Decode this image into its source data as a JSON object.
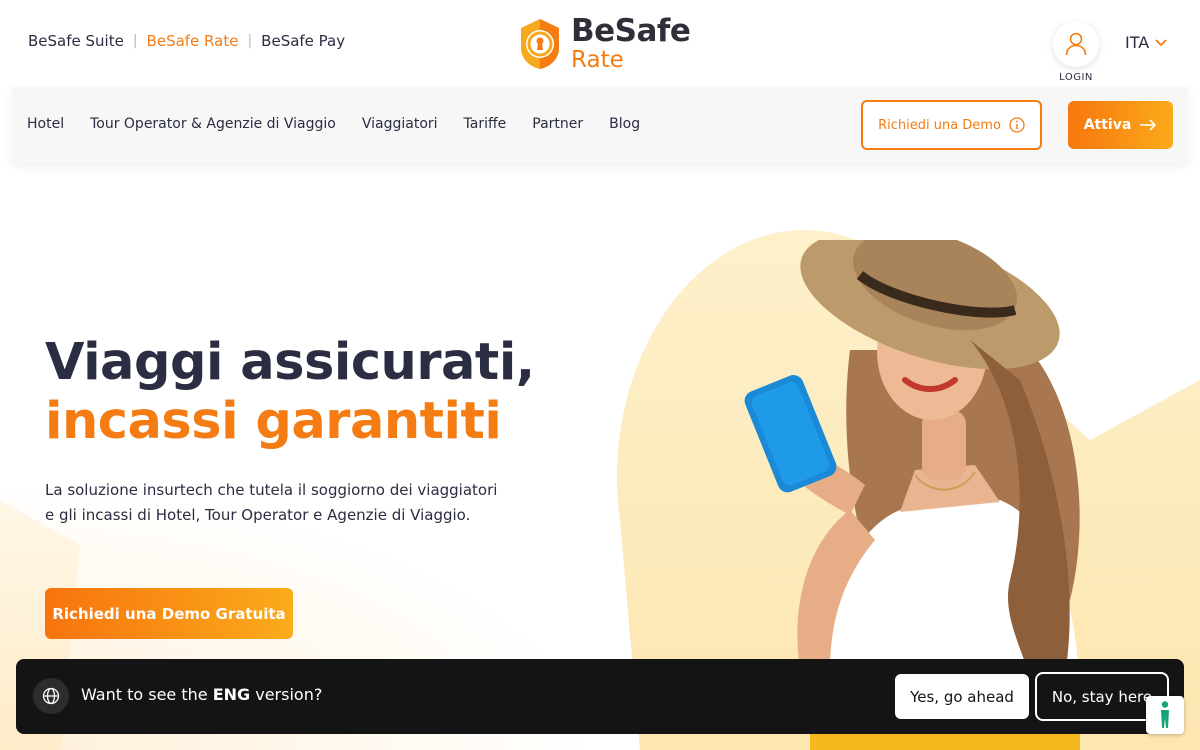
{
  "suite_nav": {
    "items": [
      {
        "label": "BeSafe Suite",
        "active": false
      },
      {
        "label": "BeSafe Rate",
        "active": true
      },
      {
        "label": "BeSafe Pay",
        "active": false
      }
    ],
    "separator": "|"
  },
  "logo": {
    "line1": "BeSafe",
    "line2": "Rate",
    "icon": "shield-keyhole-icon"
  },
  "account": {
    "login_label": "LOGIN",
    "icon": "user-icon"
  },
  "language": {
    "selected": "ITA",
    "icon": "chevron-down-icon"
  },
  "main_nav": {
    "items": [
      "Hotel",
      "Tour Operator & Agenzie di Viaggio",
      "Viaggiatori",
      "Tariffe",
      "Partner",
      "Blog"
    ],
    "demo_button": "Richiedi una Demo",
    "activate_button": "Attiva"
  },
  "hero": {
    "title_line1": "Viaggi assicurati,",
    "title_line2": "incassi garantiti",
    "description": "La soluzione insurtech che tutela il soggiorno dei viaggiatori e gli incassi di Hotel, Tour Operator e Agenzie di Viaggio.",
    "cta": "Richiedi una Demo Gratuita"
  },
  "language_banner": {
    "text_before": "Want to see the ",
    "text_bold": "ENG",
    "text_after": " version?",
    "yes_button": "Yes, go ahead",
    "no_button": "No, stay here"
  },
  "colors": {
    "accent": "#f47c13",
    "dark": "#2b2d42",
    "banner": "#141414",
    "blob": "#fde9b5"
  }
}
